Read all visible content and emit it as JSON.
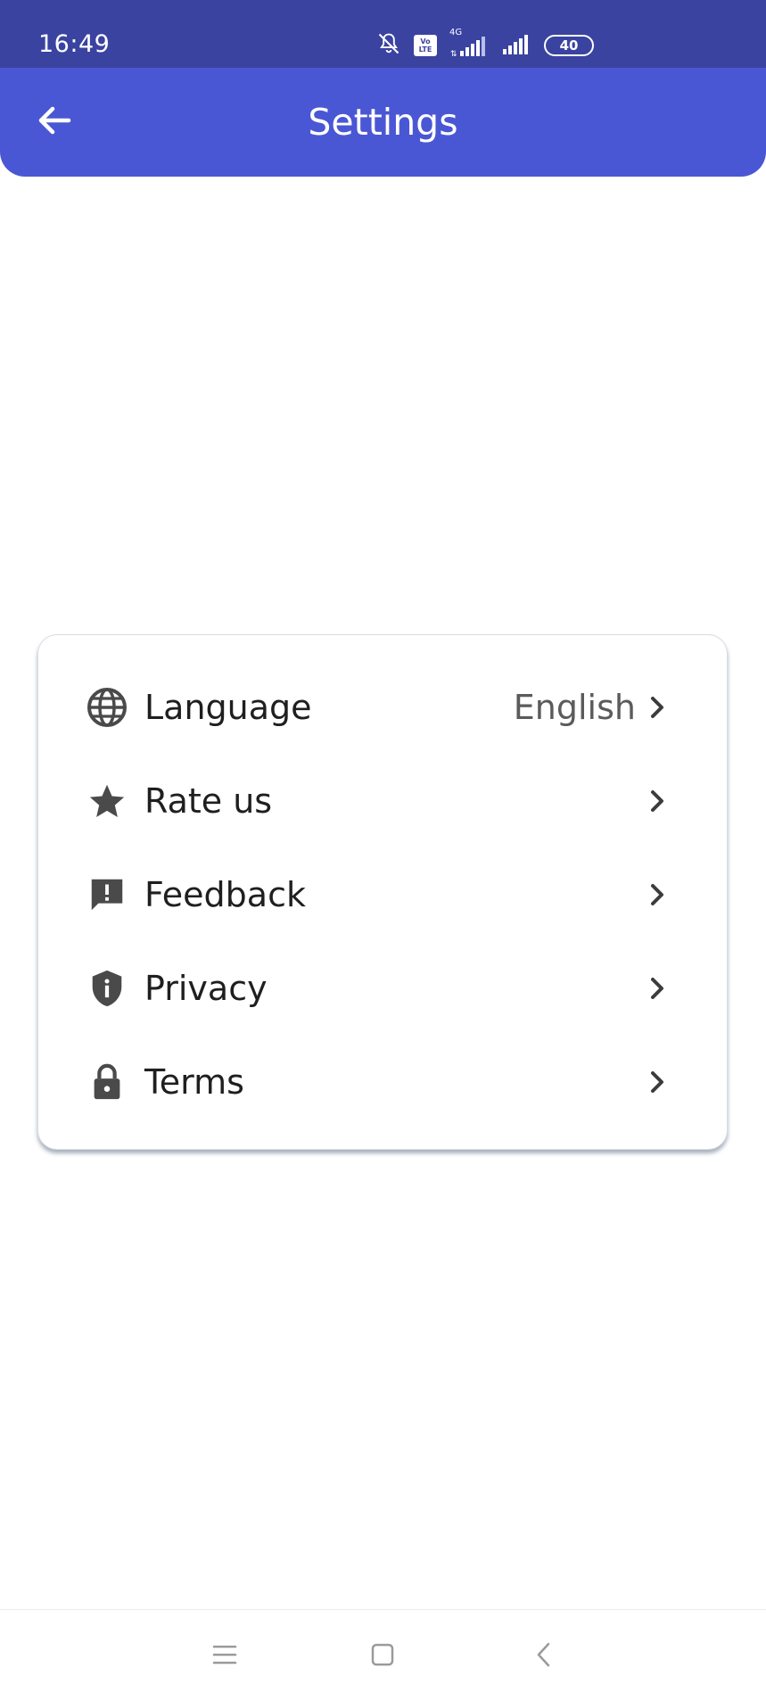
{
  "status_bar": {
    "time": "16:49",
    "network_type": "4G",
    "volte_label": "Vo LTE",
    "battery": "40",
    "icons": [
      "mute-icon",
      "volte-icon",
      "signal-icon",
      "signal-icon",
      "battery-icon"
    ]
  },
  "app_bar": {
    "title": "Settings",
    "back_icon": "arrow-left-icon",
    "background": "#4a57d4"
  },
  "settings": {
    "items": [
      {
        "label": "Language",
        "value": "English",
        "icon": "globe-icon"
      },
      {
        "label": "Rate us",
        "value": "",
        "icon": "star-icon"
      },
      {
        "label": "Feedback",
        "value": "",
        "icon": "feedback-icon"
      },
      {
        "label": "Privacy",
        "value": "",
        "icon": "shield-icon"
      },
      {
        "label": "Terms",
        "value": "",
        "icon": "lock-icon"
      }
    ]
  },
  "nav_bar": {
    "buttons": [
      "menu-icon",
      "home-square-icon",
      "back-chevron-icon"
    ]
  },
  "colors": {
    "status_bar": "#3a43a0",
    "accent": "#4a57d4",
    "icon": "#4a4a4a",
    "text": "#1f1f1f"
  }
}
